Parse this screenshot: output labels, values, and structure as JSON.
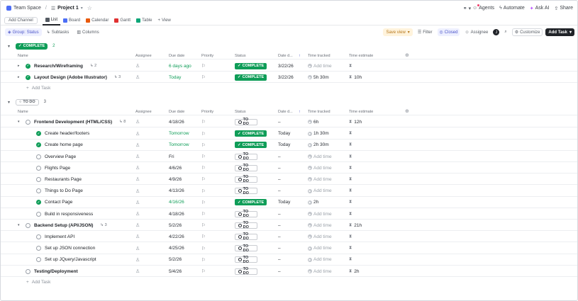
{
  "topbar": {
    "space": "Team Space",
    "project": "Project 1",
    "agents": "Agents",
    "automate": "Automate",
    "ask_ai": "Ask AI",
    "share": "Share"
  },
  "views": {
    "add_channel": "Add Channel",
    "tabs": [
      {
        "label": "List",
        "color": "#555b63",
        "active": true
      },
      {
        "label": "Board",
        "color": "#4c6ef5",
        "active": false
      },
      {
        "label": "Calendar",
        "color": "#e8590c",
        "active": false
      },
      {
        "label": "Gantt",
        "color": "#e03131",
        "active": false
      },
      {
        "label": "Table",
        "color": "#0ca678",
        "active": false
      }
    ],
    "add_view": "View"
  },
  "toolbar": {
    "group": "Group: Status",
    "subtasks": "Subtasks",
    "columns": "Columns",
    "save_view": "Save view",
    "filter": "Filter",
    "closed": "Closed",
    "assignee": "Assignee",
    "avatar": "J",
    "customize": "Customize",
    "add_task": "Add Task"
  },
  "columns": {
    "name": "Name",
    "assignee": "Assignee",
    "due": "Due date",
    "priority": "Priority",
    "status": "Status",
    "date_done": "Date d...",
    "tracked": "Time tracked",
    "estimate": "Time estimate"
  },
  "add_task_label": "Add Task",
  "add_time_label": "Add time",
  "groups": [
    {
      "label": "COMPLETE",
      "count": "2",
      "kind": "complete",
      "rows": [
        {
          "name": "Research/Wireframing",
          "level": 0,
          "bold": true,
          "expander": true,
          "done": true,
          "subtasks": "2",
          "due": "6 days ago",
          "due_green": true,
          "status": "COMPLETE",
          "date_done": "3/22/26",
          "tracked": "",
          "estimate": ""
        },
        {
          "name": "Layout Design (Adobe Illustrator)",
          "level": 0,
          "bold": true,
          "expander": true,
          "done": true,
          "subtasks": "3",
          "due": "Today",
          "due_green": true,
          "status": "COMPLETE",
          "date_done": "3/22/26",
          "tracked": "5h 30m",
          "estimate": "10h"
        }
      ]
    },
    {
      "label": "TO DO",
      "count": "3",
      "kind": "todo",
      "rows": [
        {
          "name": "Frontend Development (HTML/CSS)",
          "level": 0,
          "bold": true,
          "expander": true,
          "expanded": true,
          "done": false,
          "subtasks": "8",
          "due": "4/18/26",
          "due_green": false,
          "status": "TO DO",
          "date_done": "–",
          "tracked": "6h",
          "estimate": "12h"
        },
        {
          "name": "Create header/footers",
          "level": 1,
          "bold": false,
          "done": true,
          "due": "Tomorrow",
          "due_green": true,
          "status": "COMPLETE",
          "date_done": "Today",
          "tracked": "1h 30m",
          "estimate": ""
        },
        {
          "name": "Create home page",
          "level": 1,
          "bold": false,
          "done": true,
          "due": "Tomorrow",
          "due_green": true,
          "status": "COMPLETE",
          "date_done": "Today",
          "tracked": "2h 30m",
          "estimate": ""
        },
        {
          "name": "Overview Page",
          "level": 1,
          "bold": false,
          "done": false,
          "due": "Fri",
          "due_green": false,
          "status": "TO DO",
          "date_done": "–",
          "tracked": "",
          "estimate": ""
        },
        {
          "name": "Flights Page",
          "level": 1,
          "bold": false,
          "done": false,
          "due": "4/6/26",
          "due_green": false,
          "status": "TO DO",
          "date_done": "–",
          "tracked": "",
          "estimate": ""
        },
        {
          "name": "Restaurants Page",
          "level": 1,
          "bold": false,
          "done": false,
          "due": "4/9/26",
          "due_green": false,
          "status": "TO DO",
          "date_done": "–",
          "tracked": "",
          "estimate": ""
        },
        {
          "name": "Things to Do Page",
          "level": 1,
          "bold": false,
          "done": false,
          "due": "4/13/26",
          "due_green": false,
          "status": "TO DO",
          "date_done": "–",
          "tracked": "",
          "estimate": ""
        },
        {
          "name": "Contact Page",
          "level": 1,
          "bold": false,
          "done": true,
          "due": "4/16/26",
          "due_green": true,
          "status": "COMPLETE",
          "date_done": "Today",
          "tracked": "2h",
          "estimate": ""
        },
        {
          "name": "Build in responsiveness",
          "level": 1,
          "bold": false,
          "done": false,
          "due": "4/18/26",
          "due_green": false,
          "status": "TO DO",
          "date_done": "–",
          "tracked": "",
          "estimate": ""
        },
        {
          "name": "Backend Setup (API/JSON)",
          "level": 0,
          "bold": true,
          "expander": true,
          "expanded": true,
          "done": false,
          "subtasks": "3",
          "due": "5/2/26",
          "due_green": false,
          "status": "TO DO",
          "date_done": "–",
          "tracked": "",
          "estimate": "21h"
        },
        {
          "name": "Implement API",
          "level": 1,
          "bold": false,
          "done": false,
          "due": "4/22/26",
          "due_green": false,
          "status": "TO DO",
          "date_done": "–",
          "tracked": "",
          "estimate": ""
        },
        {
          "name": "Set up JSON connection",
          "level": 1,
          "bold": false,
          "done": false,
          "due": "4/25/26",
          "due_green": false,
          "status": "TO DO",
          "date_done": "–",
          "tracked": "",
          "estimate": ""
        },
        {
          "name": "Set up JQuery/Javascript",
          "level": 1,
          "bold": false,
          "done": false,
          "due": "5/2/26",
          "due_green": false,
          "status": "TO DO",
          "date_done": "–",
          "tracked": "",
          "estimate": ""
        },
        {
          "name": "Testing/Deployment",
          "level": 0,
          "bold": true,
          "expander": false,
          "done": false,
          "due": "5/4/26",
          "due_green": false,
          "status": "TO DO",
          "date_done": "–",
          "tracked": "",
          "estimate": "2h"
        }
      ]
    }
  ]
}
